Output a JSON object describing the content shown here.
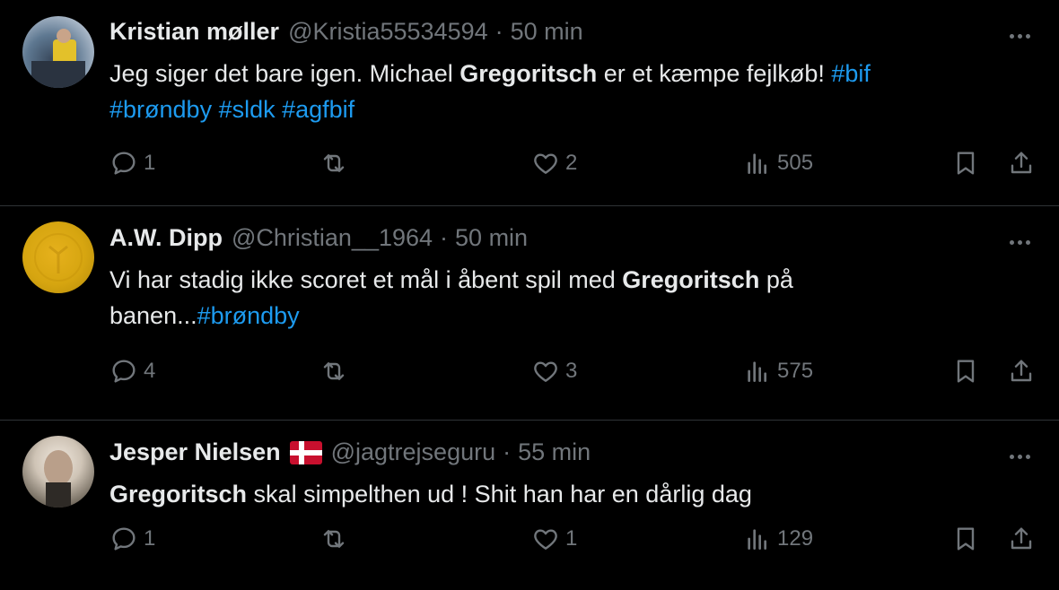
{
  "tweets": [
    {
      "name": "Kristian møller",
      "handle": "@Kristia55534594",
      "sep": "·",
      "time": "50 min",
      "text": {
        "p1": "Jeg siger det bare igen. Michael ",
        "bold": "Gregoritsch",
        "p2": " er et kæmpe fejlkøb! ",
        "tags1": "#bif",
        "tags2": "#brøndby #sldk #agfbif"
      },
      "replies": "1",
      "likes": "2",
      "views": "505"
    },
    {
      "name": "A.W. Dipp",
      "handle": "@Christian__1964",
      "sep": "·",
      "time": "50 min",
      "text": {
        "p1": "Vi har stadig ikke scoret et mål i åbent spil med ",
        "bold": "Gregoritsch",
        "p2": " på",
        "p3": "banen...",
        "tag": "#brøndby"
      },
      "replies": "4",
      "likes": "3",
      "views": "575"
    },
    {
      "name": "Jesper Nielsen",
      "flag": "Denmark",
      "handle": "@jagtrejseguru",
      "sep": "·",
      "time": "55 min",
      "text": {
        "bold": "Gregoritsch",
        "p1": " skal simpelthen ud ! Shit han har en dårlig dag"
      },
      "replies": "1",
      "likes": "1",
      "views": "129"
    }
  ],
  "colors": {
    "background": "#000000",
    "text": "#e7e9ea",
    "muted": "#71767b",
    "link": "#1d9bf0",
    "divider": "#2f3336"
  },
  "icons": [
    "reply-icon",
    "retweet-icon",
    "like-icon",
    "views-icon",
    "bookmark-icon",
    "share-icon",
    "more-icon"
  ]
}
